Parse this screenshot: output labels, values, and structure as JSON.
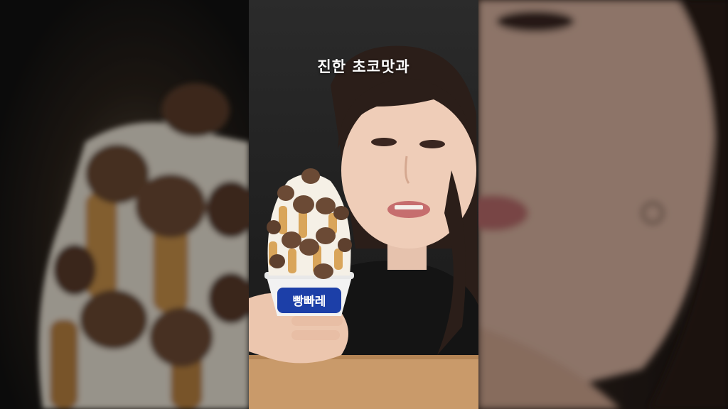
{
  "caption": {
    "text": "진한 초코맛과"
  },
  "product": {
    "cup_label": "빵빠레"
  },
  "colors": {
    "background": "#1f1f1f",
    "caption_text": "#ffffff",
    "chocolate": "#6b4a35",
    "biscuit": "#d9a55a",
    "cream": "#f5f0e6",
    "cup_blue": "#1c3fa8",
    "table": "#c99a6a"
  }
}
